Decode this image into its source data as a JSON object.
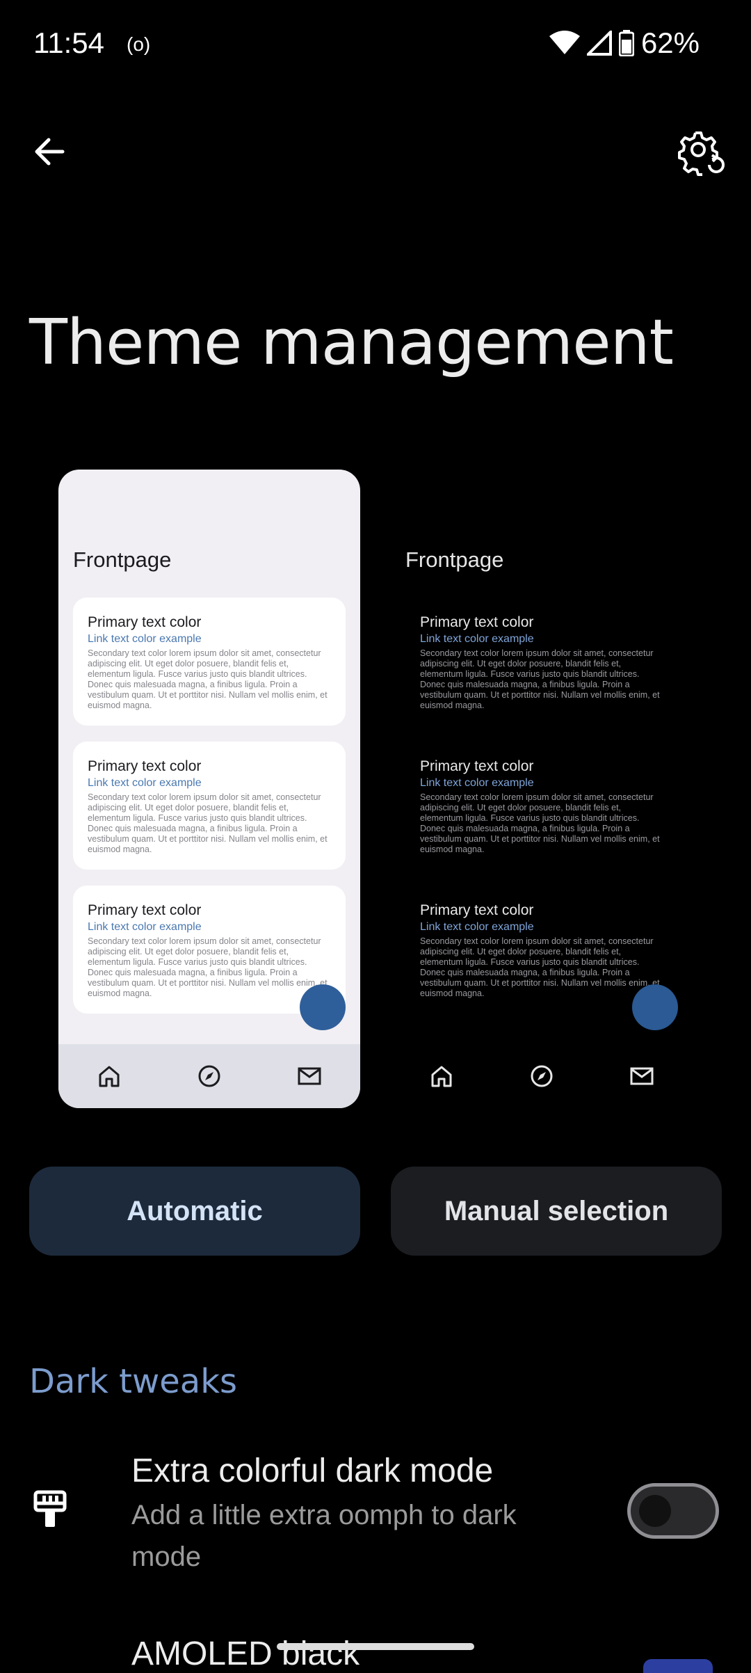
{
  "status_bar": {
    "time": "11:54",
    "radio_indicator": "(o)",
    "battery": "62%"
  },
  "top_bar": {
    "back_icon": "arrow-back-icon",
    "settings_icon": "settings-sync-icon"
  },
  "page_title": "Theme management",
  "previews": {
    "header": "Frontpage",
    "cards": [
      {
        "primary": "Primary text color",
        "link": "Link text color example",
        "secondary": "Secondary text color lorem ipsum dolor sit amet, consectetur adipiscing elit. Ut eget dolor posuere, blandit felis et, elementum ligula. Fusce varius justo quis blandit ultrices. Donec quis malesuada magna, a finibus ligula. Proin a vestibulum quam. Ut et porttitor nisi. Nullam vel mollis enim, et euismod magna."
      },
      {
        "primary": "Primary text color",
        "link": "Link text color example",
        "secondary": "Secondary text color lorem ipsum dolor sit amet, consectetur adipiscing elit. Ut eget dolor posuere, blandit felis et, elementum ligula. Fusce varius justo quis blandit ultrices. Donec quis malesuada magna, a finibus ligula. Proin a vestibulum quam. Ut et porttitor nisi. Nullam vel mollis enim, et euismod magna."
      },
      {
        "primary": "Primary text color",
        "link": "Link text color example",
        "secondary": "Secondary text color lorem ipsum dolor sit amet, consectetur adipiscing elit. Ut eget dolor posuere, blandit felis et, elementum ligula. Fusce varius justo quis blandit ultrices. Donec quis malesuada magna, a finibus ligula. Proin a vestibulum quam. Ut et porttitor nisi. Nullam vel mollis enim, et euismod magna."
      }
    ],
    "nav_icons": [
      "home-icon",
      "compass-icon",
      "mail-icon"
    ]
  },
  "mode_buttons": {
    "automatic": "Automatic",
    "manual": "Manual selection"
  },
  "dark_tweaks": {
    "section_title": "Dark tweaks",
    "extra_colorful": {
      "title": "Extra colorful dark mode",
      "summary": "Add a little extra oomph to dark mode",
      "icon": "paint-roller-icon",
      "enabled": false
    },
    "amoled": {
      "title": "AMOLED black"
    }
  },
  "colors": {
    "accent": "#7c9ccd",
    "automatic_button_bg": "#1d2a3c",
    "manual_button_bg": "#1b1d21",
    "fab_blue": "#2f5f9a",
    "link_light": "#4a78b0",
    "link_dark": "#7fa4d8"
  }
}
